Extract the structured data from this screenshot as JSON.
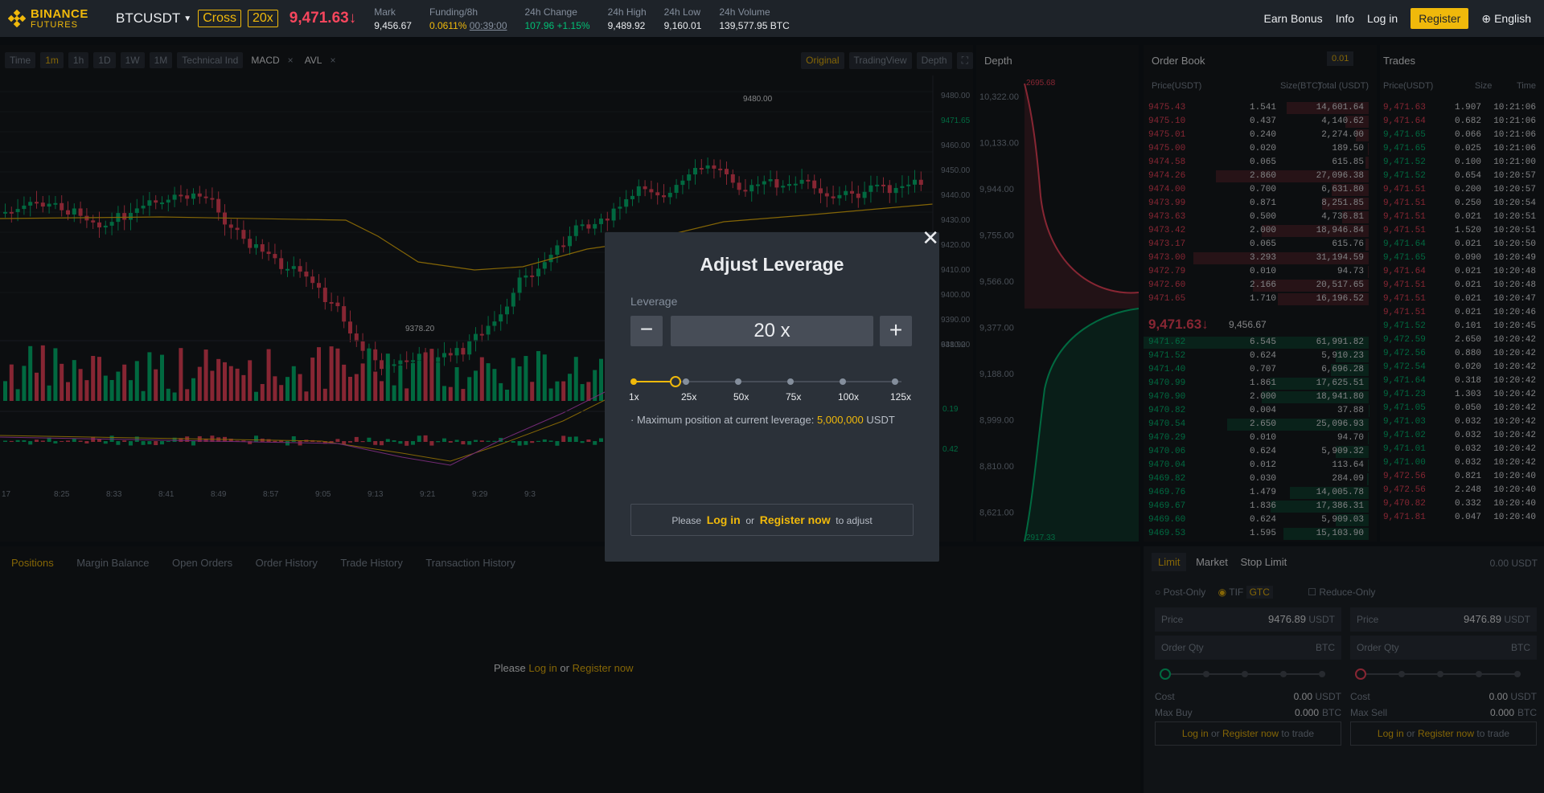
{
  "header": {
    "logo_top": "BINANCE",
    "logo_bottom": "FUTURES",
    "symbol": "BTCUSDT",
    "margin_mode": "Cross",
    "leverage": "20x",
    "last_price": "9,471.63↓",
    "stats": [
      {
        "label": "Mark",
        "value": "9,456.67"
      },
      {
        "label": "Funding/8h",
        "value": "0.0611%",
        "extra": "00:39:00"
      },
      {
        "label": "24h Change",
        "value": "107.96 +1.15%"
      },
      {
        "label": "24h High",
        "value": "9,489.92"
      },
      {
        "label": "24h Low",
        "value": "9,160.01"
      },
      {
        "label": "24h Volume",
        "value": "139,577.95 BTC"
      }
    ],
    "nav": {
      "earn_bonus": "Earn Bonus",
      "info": "Info",
      "login": "Log in",
      "register": "Register",
      "language": "English"
    }
  },
  "chart_toolbar": {
    "buttons": [
      "Time",
      "1m",
      "1h",
      "1D",
      "1W",
      "1M",
      "Technical Ind"
    ],
    "indicators": [
      "MACD",
      "AVL"
    ],
    "views": [
      "Original",
      "TradingView",
      "Depth"
    ]
  },
  "chart": {
    "price_ticks": [
      "9480.00",
      "9471.65",
      "9460.00",
      "9450.00",
      "9440.00",
      "9430.00",
      "9420.00",
      "9410.00",
      "9400.00",
      "9390.00",
      "9380.00"
    ],
    "high_label": "9480.00",
    "low_label": "9378.20",
    "vol_top": "641.92",
    "macd_a": "0.19",
    "macd_b": "0.42",
    "times": [
      "17",
      "8:25",
      "8:33",
      "8:41",
      "8:49",
      "8:57",
      "9:05",
      "9:13",
      "9:21",
      "9:29",
      "9:3"
    ]
  },
  "depth": {
    "title": "Depth",
    "ticks": [
      "10,322.00",
      "10,133.00",
      "9,944.00",
      "9,755.00",
      "9,566.00",
      "9,377.00",
      "9,188.00",
      "8,999.00",
      "8,810.00",
      "8,621.00"
    ],
    "ask_label": "2695.68",
    "bid_label": "2917.33"
  },
  "orderbook": {
    "title": "Order Book",
    "precision": "0.01",
    "headers": [
      "Price(USDT)",
      "Size(BTC)",
      "Total (USDT)"
    ],
    "asks": [
      [
        "9475.43",
        "1.541",
        "14,601.64"
      ],
      [
        "9475.10",
        "0.437",
        "4,140.62"
      ],
      [
        "9475.01",
        "0.240",
        "2,274.00"
      ],
      [
        "9475.00",
        "0.020",
        "189.50"
      ],
      [
        "9474.58",
        "0.065",
        "615.85"
      ],
      [
        "9474.26",
        "2.860",
        "27,096.38"
      ],
      [
        "9474.00",
        "0.700",
        "6,631.80"
      ],
      [
        "9473.99",
        "0.871",
        "8,251.85"
      ],
      [
        "9473.63",
        "0.500",
        "4,736.81"
      ],
      [
        "9473.42",
        "2.000",
        "18,946.84"
      ],
      [
        "9473.17",
        "0.065",
        "615.76"
      ],
      [
        "9473.00",
        "3.293",
        "31,194.59"
      ],
      [
        "9472.79",
        "0.010",
        "94.73"
      ],
      [
        "9472.60",
        "2.166",
        "20,517.65"
      ],
      [
        "9471.65",
        "1.710",
        "16,196.52"
      ]
    ],
    "mid_price": "9,471.63↓",
    "mark": "9,456.67",
    "bids": [
      [
        "9471.62",
        "6.545",
        "61,991.82"
      ],
      [
        "9471.52",
        "0.624",
        "5,910.23"
      ],
      [
        "9471.40",
        "0.707",
        "6,696.28"
      ],
      [
        "9470.99",
        "1.861",
        "17,625.51"
      ],
      [
        "9470.90",
        "2.000",
        "18,941.80"
      ],
      [
        "9470.82",
        "0.004",
        "37.88"
      ],
      [
        "9470.54",
        "2.650",
        "25,096.93"
      ],
      [
        "9470.29",
        "0.010",
        "94.70"
      ],
      [
        "9470.06",
        "0.624",
        "5,909.32"
      ],
      [
        "9470.04",
        "0.012",
        "113.64"
      ],
      [
        "9469.82",
        "0.030",
        "284.09"
      ],
      [
        "9469.76",
        "1.479",
        "14,005.78"
      ],
      [
        "9469.67",
        "1.836",
        "17,386.31"
      ],
      [
        "9469.60",
        "0.624",
        "5,909.03"
      ],
      [
        "9469.53",
        "1.595",
        "15,103.90"
      ]
    ]
  },
  "trades": {
    "title": "Trades",
    "headers": [
      "Price(USDT)",
      "Size",
      "Time"
    ],
    "rows": [
      [
        "9,471.63",
        "1.907",
        "10:21:06",
        "r"
      ],
      [
        "9,471.64",
        "0.682",
        "10:21:06",
        "r"
      ],
      [
        "9,471.65",
        "0.066",
        "10:21:06",
        "g"
      ],
      [
        "9,471.65",
        "0.025",
        "10:21:06",
        "g"
      ],
      [
        "9,471.52",
        "0.100",
        "10:21:00",
        "g"
      ],
      [
        "9,471.52",
        "0.654",
        "10:20:57",
        "g"
      ],
      [
        "9,471.51",
        "0.200",
        "10:20:57",
        "r"
      ],
      [
        "9,471.51",
        "0.250",
        "10:20:54",
        "r"
      ],
      [
        "9,471.51",
        "0.021",
        "10:20:51",
        "r"
      ],
      [
        "9,471.51",
        "1.520",
        "10:20:51",
        "r"
      ],
      [
        "9,471.64",
        "0.021",
        "10:20:50",
        "g"
      ],
      [
        "9,471.65",
        "0.090",
        "10:20:49",
        "g"
      ],
      [
        "9,471.64",
        "0.021",
        "10:20:48",
        "r"
      ],
      [
        "9,471.51",
        "0.021",
        "10:20:48",
        "r"
      ],
      [
        "9,471.51",
        "0.021",
        "10:20:47",
        "r"
      ],
      [
        "9,471.51",
        "0.021",
        "10:20:46",
        "r"
      ],
      [
        "9,471.52",
        "0.101",
        "10:20:45",
        "g"
      ],
      [
        "9,472.59",
        "2.650",
        "10:20:42",
        "g"
      ],
      [
        "9,472.56",
        "0.880",
        "10:20:42",
        "g"
      ],
      [
        "9,472.54",
        "0.020",
        "10:20:42",
        "g"
      ],
      [
        "9,471.64",
        "0.318",
        "10:20:42",
        "g"
      ],
      [
        "9,471.23",
        "1.303",
        "10:20:42",
        "g"
      ],
      [
        "9,471.05",
        "0.050",
        "10:20:42",
        "g"
      ],
      [
        "9,471.03",
        "0.032",
        "10:20:42",
        "g"
      ],
      [
        "9,471.02",
        "0.032",
        "10:20:42",
        "g"
      ],
      [
        "9,471.01",
        "0.032",
        "10:20:42",
        "g"
      ],
      [
        "9,471.00",
        "0.032",
        "10:20:42",
        "g"
      ],
      [
        "9,472.56",
        "0.821",
        "10:20:40",
        "r"
      ],
      [
        "9,472.56",
        "2.248",
        "10:20:40",
        "r"
      ],
      [
        "9,470.82",
        "0.332",
        "10:20:40",
        "r"
      ],
      [
        "9,471.81",
        "0.047",
        "10:20:40",
        "r"
      ]
    ]
  },
  "bottom_tabs": [
    "Positions",
    "Margin Balance",
    "Open Orders",
    "Order History",
    "Trade History",
    "Transaction History"
  ],
  "bottom_msg": {
    "please": "Please",
    "login": "Log in",
    "or": "or",
    "register": "Register now"
  },
  "order_form": {
    "tabs": [
      "Limit",
      "Market",
      "Stop Limit"
    ],
    "balance": "0.00 USDT",
    "post_only": "Post-Only",
    "tif": "TIF",
    "tif_val": "GTC",
    "reduce_only": "Reduce-Only",
    "price_label": "Price",
    "price_val": "9476.89",
    "usdt": "USDT",
    "qty_label": "Order Qty",
    "btc": "BTC",
    "cost": "Cost",
    "cost_val": "0.00",
    "max_buy": "Max Buy",
    "max_sell": "Max Sell",
    "max_val": "0.000",
    "login": "Log in",
    "or": "or",
    "register": "Register now",
    "to_trade": "to trade"
  },
  "modal": {
    "title": "Adjust Leverage",
    "leverage_label": "Leverage",
    "value": "20 x",
    "slider_fraction": 0.16,
    "marks": [
      "1x",
      "25x",
      "50x",
      "75x",
      "100x",
      "125x"
    ],
    "info_prefix": "· Maximum position at current leverage:",
    "info_value": "5,000,000",
    "info_unit": "USDT",
    "please": "Please",
    "login": "Log in",
    "or": "or",
    "register": "Register now",
    "adjust": "to adjust"
  },
  "colors": {
    "accent": "#f0b90b",
    "up": "#02c076",
    "down": "#f6465d"
  }
}
